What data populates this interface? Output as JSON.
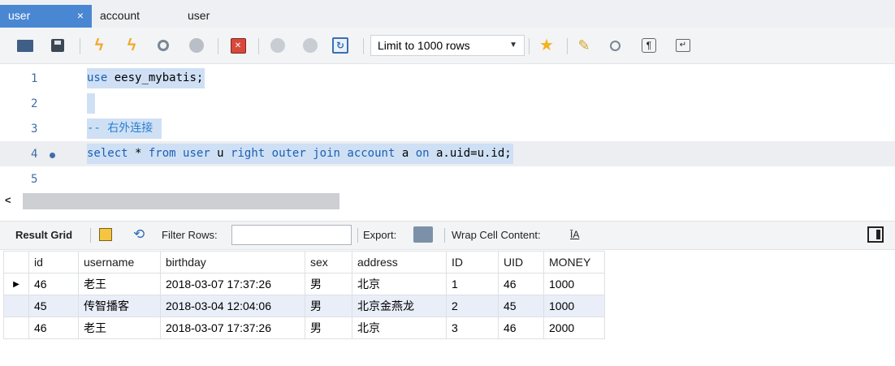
{
  "tabs": [
    {
      "label": "user",
      "active": true,
      "close": "×"
    },
    {
      "label": "account",
      "active": false
    },
    {
      "label": "user",
      "active": false
    }
  ],
  "toolbar": {
    "limit_value": "Limit to 1000 rows",
    "icons": [
      "open-folder-icon",
      "save-icon",
      "execute-icon",
      "execute-current-icon",
      "explain-icon",
      "stop-icon",
      "error-toggle-icon",
      "commit-icon",
      "rollback-icon",
      "autocommit-icon",
      "favorite-add-icon",
      "beautify-icon",
      "find-icon",
      "invisible-chars-icon",
      "wrap-icon"
    ],
    "accent": "#4a87d3"
  },
  "editor": {
    "lines": [
      {
        "num": "1",
        "code": "use eesy_mybatis;"
      },
      {
        "num": "2",
        "code": ""
      },
      {
        "num": "3",
        "code": "-- 右外连接 "
      },
      {
        "num": "4",
        "code": "select * from user u right outer join account a on a.uid=u.id;"
      },
      {
        "num": "5",
        "code": ""
      }
    ],
    "current_line": 4
  },
  "result_toolbar": {
    "result_grid": "Result Grid",
    "filter_rows": "Filter Rows:",
    "filter_value": "",
    "export": "Export:",
    "wrap_cell": "Wrap Cell Content:",
    "wrap_glyph": "ĪA"
  },
  "grid": {
    "columns": [
      "id",
      "username",
      "birthday",
      "sex",
      "address",
      "ID",
      "UID",
      "MONEY"
    ],
    "rows": [
      [
        "46",
        "老王",
        "2018-03-07 17:37:26",
        "男",
        "北京",
        "1",
        "46",
        "1000"
      ],
      [
        "45",
        "传智播客",
        "2018-03-04 12:04:06",
        "男",
        "北京金燕龙",
        "2",
        "45",
        "1000"
      ],
      [
        "46",
        "老王",
        "2018-03-07 17:37:26",
        "男",
        "北京",
        "3",
        "46",
        "2000"
      ]
    ],
    "current_row_marker": "▶"
  }
}
